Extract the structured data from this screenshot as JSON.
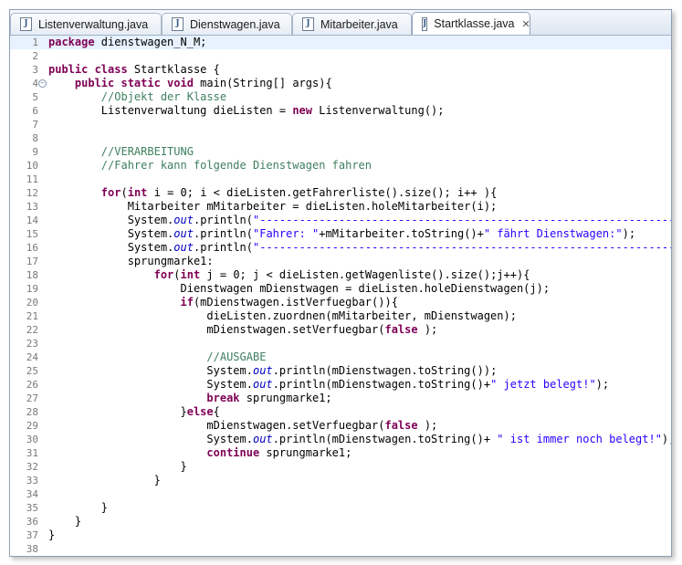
{
  "tabs": [
    {
      "label": "Listenverwaltung.java",
      "active": false
    },
    {
      "label": "Dienstwagen.java",
      "active": false
    },
    {
      "label": "Mitarbeiter.java",
      "active": false
    },
    {
      "label": "Startklasse.java",
      "active": true
    }
  ],
  "tab_icon_glyph": "J",
  "close_glyph": "✕",
  "fold_glyph": "−",
  "current_line": 1,
  "colors": {
    "keyword": "#7f0055",
    "comment": "#3f7f5f",
    "string": "#2a00ff",
    "field": "#0000c0",
    "current_line_bg": "#e8f2fe"
  },
  "lines": [
    [
      [
        "kw",
        "package"
      ],
      [
        "",
        "dienstwagen_N_M;"
      ]
    ],
    [],
    [
      [
        "kw",
        "public class"
      ],
      [
        "",
        "Startklasse {"
      ]
    ],
    [
      [
        "",
        "    "
      ],
      [
        "kw",
        "public static void"
      ],
      [
        "",
        "main(String[] args){"
      ]
    ],
    [
      [
        "",
        "        "
      ],
      [
        "cm",
        "//Objekt der Klasse"
      ]
    ],
    [
      [
        "",
        "        Listenverwaltung dieListen = "
      ],
      [
        "kw",
        "new"
      ],
      [
        "",
        "Listenverwaltung();"
      ]
    ],
    [],
    [],
    [
      [
        "",
        "        "
      ],
      [
        "cm",
        "//VERARBEITUNG"
      ]
    ],
    [
      [
        "",
        "        "
      ],
      [
        "cm",
        "//Fahrer kann folgende Dienstwagen fahren"
      ]
    ],
    [],
    [
      [
        "",
        "        "
      ],
      [
        "kw",
        "for"
      ],
      [
        "",
        "("
      ],
      [
        "kw",
        "int"
      ],
      [
        "",
        "i = 0; i < dieListen.getFahrerliste().size(); i++ ){"
      ]
    ],
    [
      [
        "",
        "            Mitarbeiter mMitarbeiter = dieListen.holeMitarbeiter(i);"
      ]
    ],
    [
      [
        "",
        "            System."
      ],
      [
        "fd",
        "out"
      ],
      [
        "",
        ".println("
      ],
      [
        "st",
        "\"----------------------------------------------------------------\""
      ],
      [
        "",
        ");"
      ]
    ],
    [
      [
        "",
        "            System."
      ],
      [
        "fd",
        "out"
      ],
      [
        "",
        ".println("
      ],
      [
        "st",
        "\"Fahrer: \""
      ],
      [
        "",
        "+mMitarbeiter.toString()+"
      ],
      [
        "st",
        "\" fährt Dienstwagen:\""
      ],
      [
        "",
        ");"
      ]
    ],
    [
      [
        "",
        "            System."
      ],
      [
        "fd",
        "out"
      ],
      [
        "",
        ".println("
      ],
      [
        "st",
        "\"----------------------------------------------------------------\""
      ],
      [
        "",
        ");"
      ]
    ],
    [
      [
        "",
        "            sprungmarke1:"
      ]
    ],
    [
      [
        "",
        "                "
      ],
      [
        "kw",
        "for"
      ],
      [
        "",
        "("
      ],
      [
        "kw",
        "int"
      ],
      [
        "",
        "j = 0; j < dieListen.getWagenliste().size();j++){"
      ]
    ],
    [
      [
        "",
        "                    Dienstwagen mDienstwagen = dieListen.holeDienstwagen(j);"
      ]
    ],
    [
      [
        "",
        "                    "
      ],
      [
        "kw",
        "if"
      ],
      [
        "",
        "(mDienstwagen.istVerfuegbar()){"
      ]
    ],
    [
      [
        "",
        "                        dieListen.zuordnen(mMitarbeiter, mDienstwagen);"
      ]
    ],
    [
      [
        "",
        "                        mDienstwagen.setVerfuegbar("
      ],
      [
        "kw",
        "false"
      ],
      [
        "",
        ");"
      ]
    ],
    [],
    [
      [
        "",
        "                        "
      ],
      [
        "cm",
        "//AUSGABE"
      ]
    ],
    [
      [
        "",
        "                        System."
      ],
      [
        "fd",
        "out"
      ],
      [
        "",
        ".println(mDienstwagen.toString());"
      ]
    ],
    [
      [
        "",
        "                        System."
      ],
      [
        "fd",
        "out"
      ],
      [
        "",
        ".println(mDienstwagen.toString()+"
      ],
      [
        "st",
        "\" jetzt belegt!\""
      ],
      [
        "",
        ");"
      ]
    ],
    [
      [
        "",
        "                        "
      ],
      [
        "kw",
        "break"
      ],
      [
        "",
        "sprungmarke1;"
      ]
    ],
    [
      [
        "",
        "                    }"
      ],
      [
        "kw",
        "else"
      ],
      [
        "",
        "{"
      ]
    ],
    [
      [
        "",
        "                        mDienstwagen.setVerfuegbar("
      ],
      [
        "kw",
        "false"
      ],
      [
        "",
        ");"
      ]
    ],
    [
      [
        "",
        "                        System."
      ],
      [
        "fd",
        "out"
      ],
      [
        "",
        ".println(mDienstwagen.toString()+ "
      ],
      [
        "st",
        "\" ist immer noch belegt!\""
      ],
      [
        "",
        ");"
      ]
    ],
    [
      [
        "",
        "                        "
      ],
      [
        "kw",
        "continue"
      ],
      [
        "",
        "sprungmarke1;"
      ]
    ],
    [
      [
        "",
        "                    }"
      ]
    ],
    [
      [
        "",
        "                }"
      ]
    ],
    [],
    [
      [
        "",
        "        }"
      ]
    ],
    [
      [
        "",
        "    }"
      ]
    ],
    [
      [
        "",
        "}"
      ]
    ],
    []
  ]
}
